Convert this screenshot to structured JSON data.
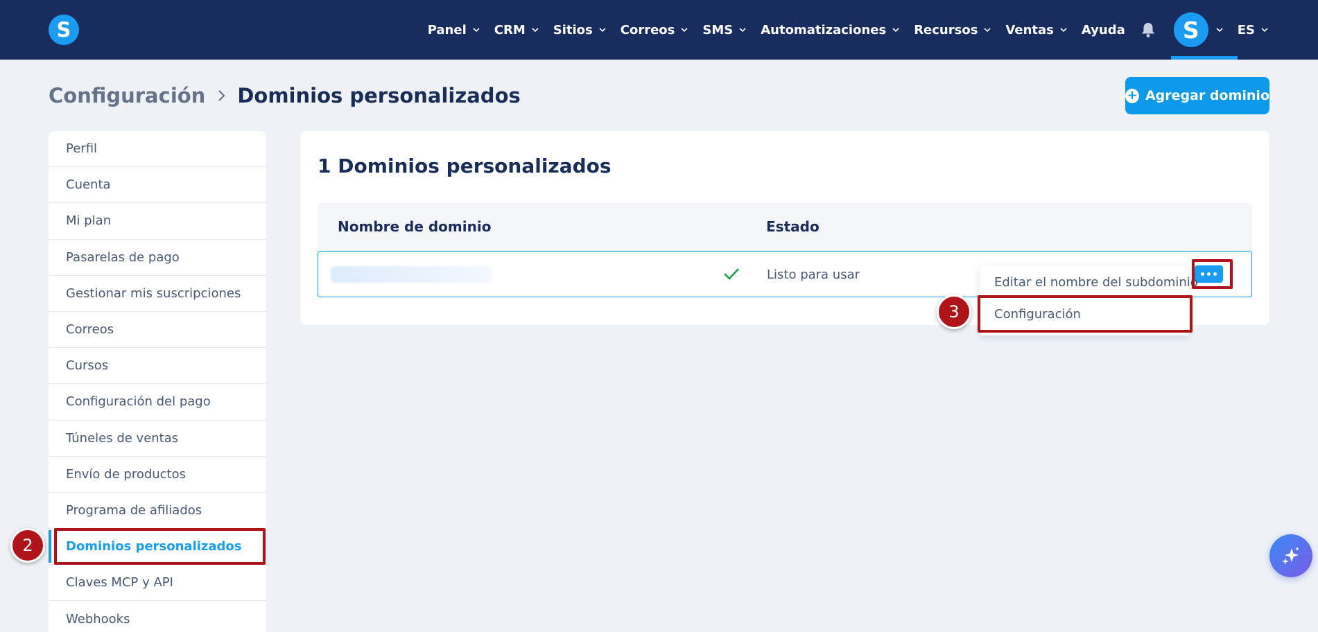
{
  "app": {
    "logo_letter": "S"
  },
  "nav": {
    "items": [
      {
        "label": "Panel",
        "has_dropdown": true
      },
      {
        "label": "CRM",
        "has_dropdown": true
      },
      {
        "label": "Sitios",
        "has_dropdown": true
      },
      {
        "label": "Correos",
        "has_dropdown": true
      },
      {
        "label": "SMS",
        "has_dropdown": true
      },
      {
        "label": "Automatizaciones",
        "has_dropdown": true
      },
      {
        "label": "Recursos",
        "has_dropdown": true
      },
      {
        "label": "Ventas",
        "has_dropdown": true
      },
      {
        "label": "Ayuda",
        "has_dropdown": false
      }
    ],
    "avatar_letter": "S",
    "language": "ES"
  },
  "header": {
    "breadcrumb_root": "Configuración",
    "breadcrumb_current": "Dominios personalizados",
    "add_button_label": "Agregar dominio"
  },
  "sidebar": {
    "items": [
      {
        "label": "Perfil"
      },
      {
        "label": "Cuenta"
      },
      {
        "label": "Mi plan"
      },
      {
        "label": "Pasarelas de pago"
      },
      {
        "label": "Gestionar mis suscripciones"
      },
      {
        "label": "Correos"
      },
      {
        "label": "Cursos"
      },
      {
        "label": "Configuración del pago"
      },
      {
        "label": "Túneles de ventas"
      },
      {
        "label": "Envío de productos"
      },
      {
        "label": "Programa de afiliados"
      },
      {
        "label": "Dominios personalizados",
        "active": true
      },
      {
        "label": "Claves MCP y API"
      },
      {
        "label": "Webhooks"
      }
    ]
  },
  "main": {
    "card_title": "1 Dominios personalizados",
    "table": {
      "columns": [
        "Nombre de dominio",
        "Estado"
      ],
      "rows": [
        {
          "domain": "",
          "status": "Listo para usar"
        }
      ]
    }
  },
  "dropdown": {
    "items": [
      {
        "label": "Editar el nombre del subdominio"
      },
      {
        "label": "Configuración"
      }
    ]
  },
  "annotations": {
    "step_2": "2",
    "step_3": "3"
  },
  "colors": {
    "nav_bg": "#182d5e",
    "accent": "#1a9cf3",
    "highlight": "#b0141b",
    "success": "#16a34a"
  }
}
